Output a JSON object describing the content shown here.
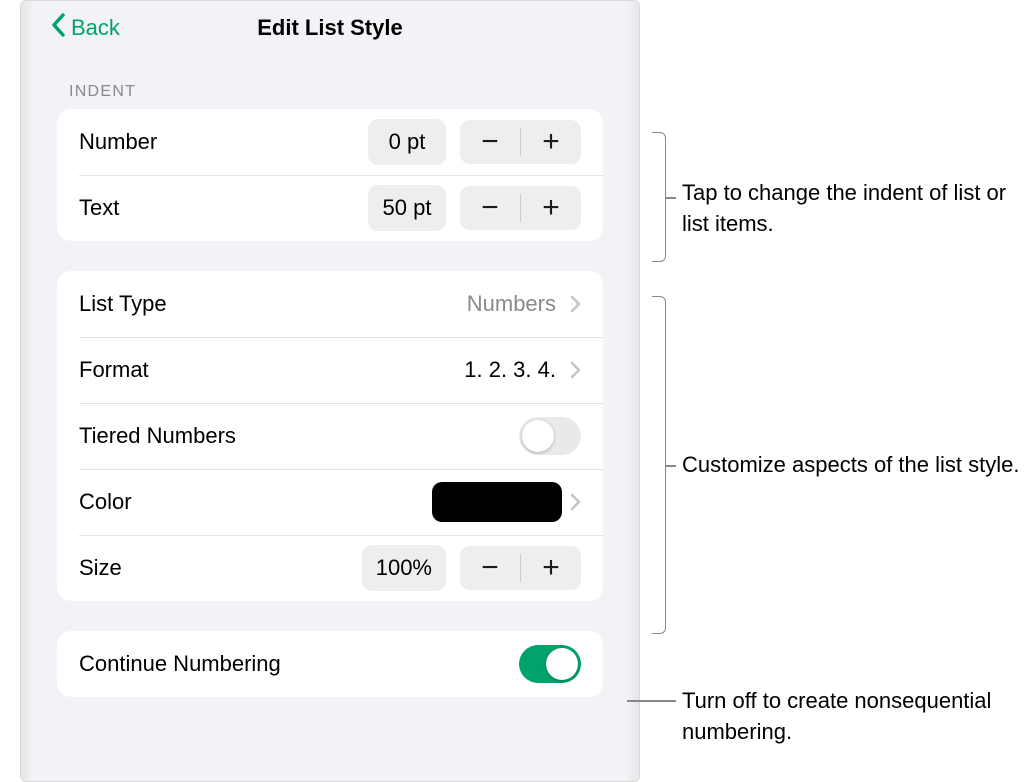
{
  "nav": {
    "back_label": "Back",
    "title": "Edit List Style"
  },
  "section_indent_header": "INDENT",
  "indent": {
    "number_label": "Number",
    "number_value": "0 pt",
    "text_label": "Text",
    "text_value": "50 pt"
  },
  "style": {
    "list_type_label": "List Type",
    "list_type_value": "Numbers",
    "format_label": "Format",
    "format_value": "1. 2. 3. 4.",
    "tiered_label": "Tiered Numbers",
    "tiered_on": false,
    "color_label": "Color",
    "color_value": "#000000",
    "size_label": "Size",
    "size_value": "100%"
  },
  "continue": {
    "label": "Continue Numbering",
    "on": true
  },
  "annotations": {
    "indent": "Tap to change the indent of list or list items.",
    "style": "Customize aspects of the list style.",
    "continue": "Turn off to create nonsequential numbering."
  },
  "glyphs": {
    "minus": "−",
    "plus": "+"
  }
}
